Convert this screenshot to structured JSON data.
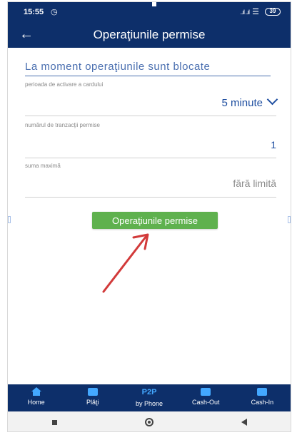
{
  "status_bar": {
    "time": "15:55",
    "battery": "39",
    "signal": "..ıl ..ıl"
  },
  "app_bar": {
    "back_icon": "arrow-left-icon",
    "title": "Operaţiunile permise"
  },
  "main": {
    "heading": "La moment operaţiunile sunt blocate",
    "fields": [
      {
        "label": "perioada de activare a cardului",
        "value": "5 minute",
        "icon": "chevron-down-icon"
      },
      {
        "label": "numărul de tranzacţii permise",
        "value": "1"
      },
      {
        "label": "suma maximă",
        "value": "fără limită"
      }
    ],
    "action_button": "Operaţiunile permise"
  },
  "tab_bar": {
    "items": [
      {
        "label": "Home",
        "icon": "home-icon"
      },
      {
        "label": "Plăţi",
        "icon": "card-icon"
      },
      {
        "icon_text": "P2P",
        "label": "by Phone"
      },
      {
        "label": "Cash-Out",
        "icon": "atm-icon"
      },
      {
        "label": "Cash-In",
        "icon": "atm-icon"
      }
    ]
  },
  "colors": {
    "primary": "#0d2f6a",
    "accent": "#43a8ff",
    "button_green": "#5fb14e",
    "annotation_arrow": "#d23a3a"
  }
}
